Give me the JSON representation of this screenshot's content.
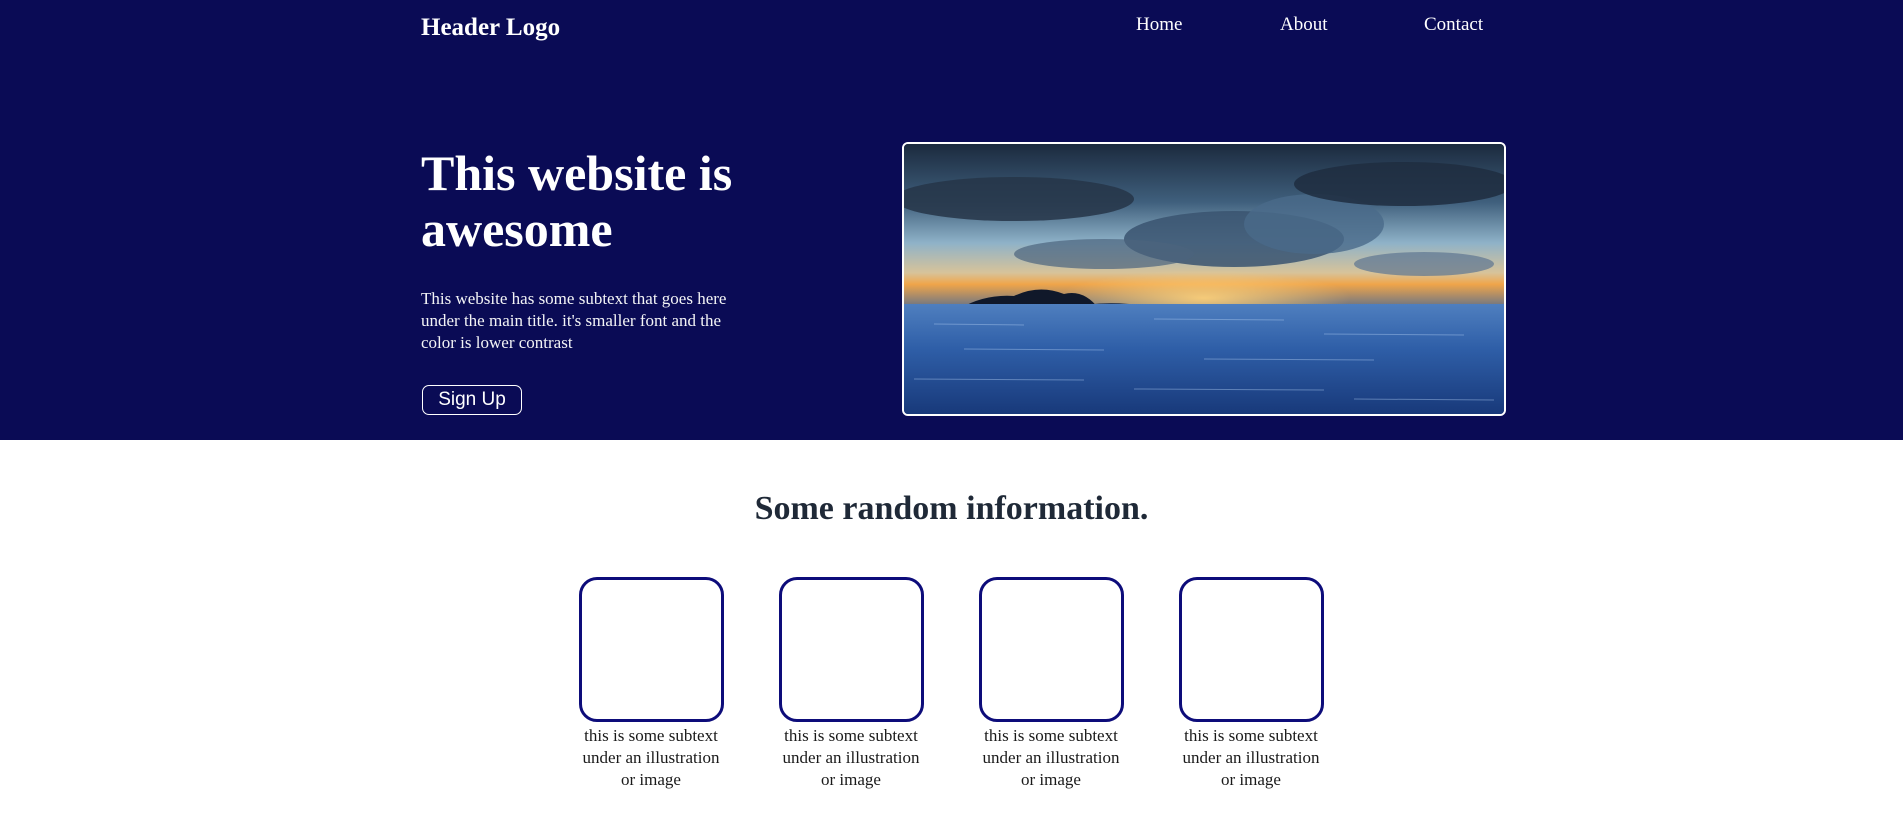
{
  "header": {
    "logo": "Header Logo",
    "nav": [
      "Home",
      "About",
      "Contact"
    ]
  },
  "hero": {
    "title": "This website is awesome",
    "subtext": "This website has some subtext that goes here under the main title. it's smaller font and the color is lower contrast",
    "signup_label": "Sign Up",
    "image_icon": "seascape-sunset-image"
  },
  "info": {
    "title": "Some random information.",
    "cards": [
      {
        "text": "this is some subtext under an illustration or image"
      },
      {
        "text": "this is some subtext under an illustration or image"
      },
      {
        "text": "this is some subtext under an illustration or image"
      },
      {
        "text": "this is some subtext under an illustration or image"
      }
    ]
  },
  "colors": {
    "hero_background": "#0a0b55",
    "card_border": "#0d0c7a",
    "heading_text": "#1f2937"
  }
}
